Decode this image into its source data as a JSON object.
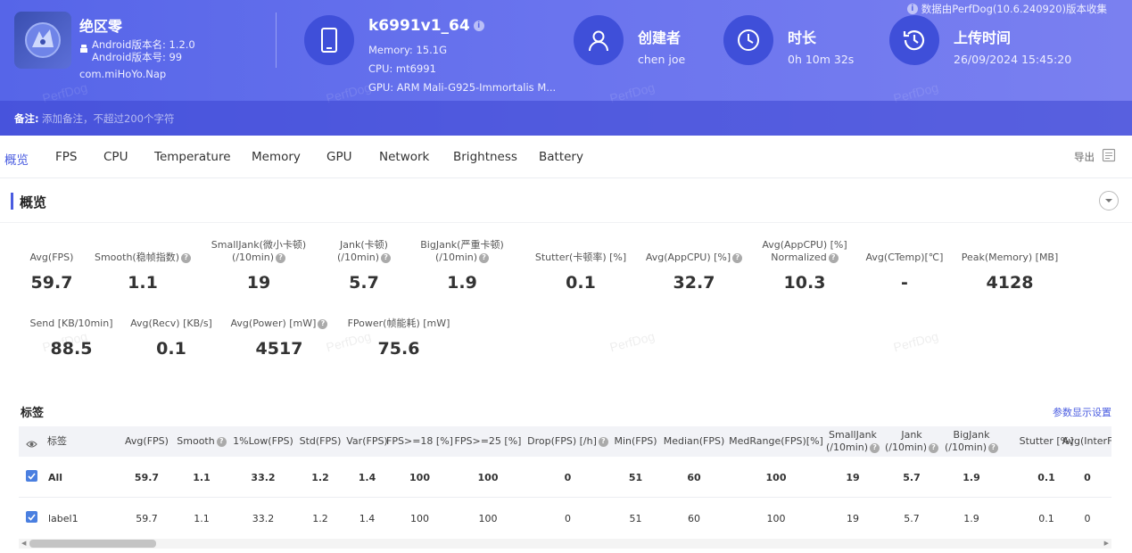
{
  "app": {
    "name": "绝区零",
    "version_name": "Android版本名: 1.2.0",
    "version_code": "Android版本号: 99",
    "package": "com.miHoYo.Nap"
  },
  "device": {
    "name": "k6991v1_64",
    "memory": "Memory: 15.1G",
    "cpu": "CPU: mt6991",
    "gpu": "GPU: ARM Mali-G925-Immortalis M..."
  },
  "creator": {
    "label": "创建者",
    "value": "chen joe"
  },
  "duration": {
    "label": "时长",
    "value": "0h 10m 32s"
  },
  "upload": {
    "label": "上传时间",
    "value": "26/09/2024 15:45:20"
  },
  "source_note": "数据由PerfDog(10.6.240920)版本收集",
  "note": {
    "label": "备注:",
    "placeholder": "添加备注，不超过200个字符"
  },
  "watermark": "PerfDog",
  "tabs": [
    "概览",
    "FPS",
    "CPU",
    "Temperature",
    "Memory",
    "GPU",
    "Network",
    "Brightness",
    "Battery"
  ],
  "export_label": "导出",
  "overview": {
    "title": "概览",
    "metrics_row1": [
      {
        "l1": "",
        "l2": "Avg(FPS)",
        "help": false,
        "value": "59.7"
      },
      {
        "l1": "",
        "l2": "Smooth(稳帧指数)",
        "help": true,
        "value": "1.1"
      },
      {
        "l1": "SmallJank(微小卡顿)",
        "l2": "(/10min)",
        "help": true,
        "value": "19"
      },
      {
        "l1": "Jank(卡顿)",
        "l2": "(/10min)",
        "help": true,
        "value": "5.7"
      },
      {
        "l1": "BigJank(严重卡顿)",
        "l2": "(/10min)",
        "help": true,
        "value": "1.9"
      },
      {
        "l1": "",
        "l2": "Stutter(卡顿率) [%]",
        "help": false,
        "value": "0.1"
      },
      {
        "l1": "",
        "l2": "Avg(AppCPU) [%]",
        "help": true,
        "value": "32.7"
      },
      {
        "l1": "Avg(AppCPU) [%]",
        "l2": "Normalized",
        "help": true,
        "value": "10.3"
      },
      {
        "l1": "",
        "l2": "Avg(CTemp)[℃]",
        "help": false,
        "value": "-"
      },
      {
        "l1": "",
        "l2": "Peak(Memory) [MB]",
        "help": false,
        "value": "4128"
      }
    ],
    "metrics_row2": [
      {
        "l1": "",
        "l2": "Send [KB/10min]",
        "help": false,
        "value": "88.5"
      },
      {
        "l1": "",
        "l2": "Avg(Recv) [KB/s]",
        "help": false,
        "value": "0.1"
      },
      {
        "l1": "",
        "l2": "Avg(Power) [mW]",
        "help": true,
        "value": "4517"
      },
      {
        "l1": "",
        "l2": "FPower(帧能耗) [mW]",
        "help": false,
        "value": "75.6"
      }
    ]
  },
  "table": {
    "title": "标签",
    "settings_label": "参数显示设置",
    "columns": [
      {
        "l1": "",
        "l2": "标签",
        "help": false
      },
      {
        "l1": "",
        "l2": "Avg(FPS)",
        "help": false
      },
      {
        "l1": "",
        "l2": "Smooth",
        "help": true
      },
      {
        "l1": "",
        "l2": "1%Low(FPS)",
        "help": false
      },
      {
        "l1": "",
        "l2": "Std(FPS)",
        "help": false
      },
      {
        "l1": "",
        "l2": "Var(FPS)",
        "help": false
      },
      {
        "l1": "",
        "l2": "FPS>=18 [%]",
        "help": false
      },
      {
        "l1": "",
        "l2": "FPS>=25 [%]",
        "help": false
      },
      {
        "l1": "",
        "l2": "Drop(FPS) [/h]",
        "help": true
      },
      {
        "l1": "",
        "l2": "Min(FPS)",
        "help": false
      },
      {
        "l1": "",
        "l2": "Median(FPS)",
        "help": false
      },
      {
        "l1": "",
        "l2": "MedRange(FPS)[%]",
        "help": false
      },
      {
        "l1": "SmallJank",
        "l2": "(/10min)",
        "help": true
      },
      {
        "l1": "Jank",
        "l2": "(/10min)",
        "help": true
      },
      {
        "l1": "BigJank",
        "l2": "(/10min)",
        "help": true
      },
      {
        "l1": "",
        "l2": "Stutter [%]",
        "help": false
      },
      {
        "l1": "",
        "l2": "Avg(InterF",
        "help": false
      }
    ],
    "rows": [
      {
        "cells": [
          "All",
          "59.7",
          "1.1",
          "33.2",
          "1.2",
          "1.4",
          "100",
          "100",
          "0",
          "51",
          "60",
          "100",
          "19",
          "5.7",
          "1.9",
          "0.1",
          "0"
        ]
      },
      {
        "cells": [
          "label1",
          "59.7",
          "1.1",
          "33.2",
          "1.2",
          "1.4",
          "100",
          "100",
          "0",
          "51",
          "60",
          "100",
          "19",
          "5.7",
          "1.9",
          "0.1",
          "0"
        ]
      }
    ]
  }
}
